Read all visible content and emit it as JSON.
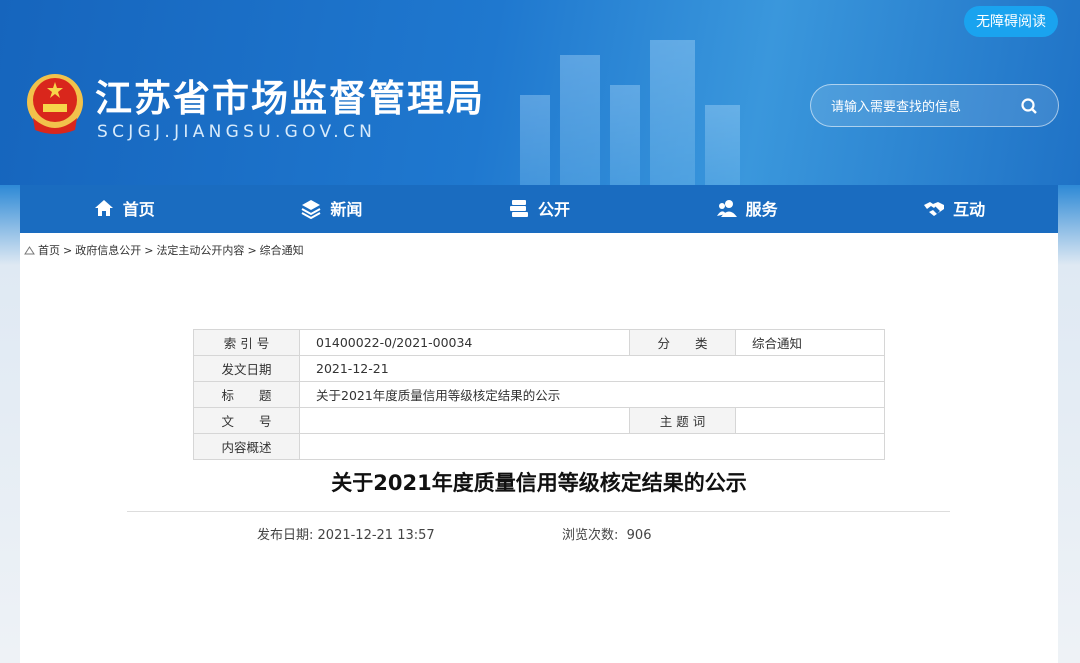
{
  "header": {
    "site_title": "江苏省市场监督管理局",
    "site_url": "SCJGJ.JIANGSU.GOV.CN",
    "accessibility_label": "无障碍阅读",
    "search_placeholder": "请输入需要查找的信息"
  },
  "nav": [
    {
      "label": "首页",
      "icon": "home-icon"
    },
    {
      "label": "新闻",
      "icon": "layers-icon"
    },
    {
      "label": "公开",
      "icon": "books-icon"
    },
    {
      "label": "服务",
      "icon": "people-icon"
    },
    {
      "label": "互动",
      "icon": "handshake-icon"
    }
  ],
  "breadcrumb": [
    "首页",
    ">",
    "政府信息公开",
    ">",
    "法定主动公开内容",
    ">",
    "综合通知"
  ],
  "info_table": {
    "index_label": "索 引 号",
    "index_value": "01400022-0/2021-00034",
    "category_label": "分　　类",
    "category_value": "综合通知",
    "date_label": "发文日期",
    "date_value": "2021-12-21",
    "title_label": "标　　题",
    "title_value": "关于2021年度质量信用等级核定结果的公示",
    "docno_label": "文　　号",
    "docno_value": "",
    "keyword_label": "主 题 词",
    "keyword_value": "",
    "summary_label": "内容概述",
    "summary_value": ""
  },
  "article": {
    "title": "关于2021年度质量信用等级核定结果的公示",
    "publish_label": "发布日期:",
    "publish_value": "2021-12-21 13:57",
    "views_label": "浏览次数:",
    "views_value": "906"
  }
}
